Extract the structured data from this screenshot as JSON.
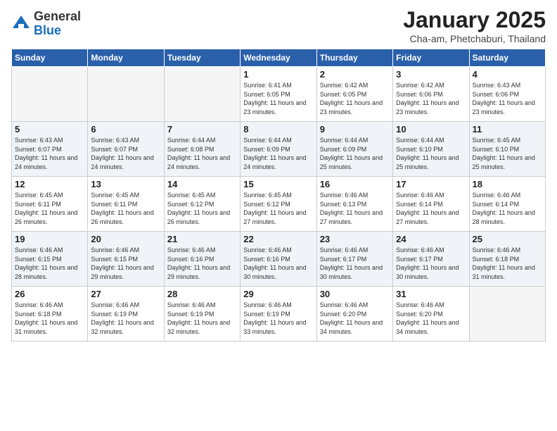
{
  "logo": {
    "general": "General",
    "blue": "Blue"
  },
  "header": {
    "title": "January 2025",
    "subtitle": "Cha-am, Phetchaburi, Thailand"
  },
  "weekdays": [
    "Sunday",
    "Monday",
    "Tuesday",
    "Wednesday",
    "Thursday",
    "Friday",
    "Saturday"
  ],
  "weeks": [
    [
      {
        "day": "",
        "sunrise": "",
        "sunset": "",
        "daylight": "",
        "empty": true
      },
      {
        "day": "",
        "sunrise": "",
        "sunset": "",
        "daylight": "",
        "empty": true
      },
      {
        "day": "",
        "sunrise": "",
        "sunset": "",
        "daylight": "",
        "empty": true
      },
      {
        "day": "1",
        "sunrise": "Sunrise: 6:41 AM",
        "sunset": "Sunset: 6:05 PM",
        "daylight": "Daylight: 11 hours and 23 minutes."
      },
      {
        "day": "2",
        "sunrise": "Sunrise: 6:42 AM",
        "sunset": "Sunset: 6:05 PM",
        "daylight": "Daylight: 11 hours and 23 minutes."
      },
      {
        "day": "3",
        "sunrise": "Sunrise: 6:42 AM",
        "sunset": "Sunset: 6:06 PM",
        "daylight": "Daylight: 11 hours and 23 minutes."
      },
      {
        "day": "4",
        "sunrise": "Sunrise: 6:43 AM",
        "sunset": "Sunset: 6:06 PM",
        "daylight": "Daylight: 11 hours and 23 minutes."
      }
    ],
    [
      {
        "day": "5",
        "sunrise": "Sunrise: 6:43 AM",
        "sunset": "Sunset: 6:07 PM",
        "daylight": "Daylight: 11 hours and 24 minutes."
      },
      {
        "day": "6",
        "sunrise": "Sunrise: 6:43 AM",
        "sunset": "Sunset: 6:07 PM",
        "daylight": "Daylight: 11 hours and 24 minutes."
      },
      {
        "day": "7",
        "sunrise": "Sunrise: 6:44 AM",
        "sunset": "Sunset: 6:08 PM",
        "daylight": "Daylight: 11 hours and 24 minutes."
      },
      {
        "day": "8",
        "sunrise": "Sunrise: 6:44 AM",
        "sunset": "Sunset: 6:09 PM",
        "daylight": "Daylight: 11 hours and 24 minutes."
      },
      {
        "day": "9",
        "sunrise": "Sunrise: 6:44 AM",
        "sunset": "Sunset: 6:09 PM",
        "daylight": "Daylight: 11 hours and 25 minutes."
      },
      {
        "day": "10",
        "sunrise": "Sunrise: 6:44 AM",
        "sunset": "Sunset: 6:10 PM",
        "daylight": "Daylight: 11 hours and 25 minutes."
      },
      {
        "day": "11",
        "sunrise": "Sunrise: 6:45 AM",
        "sunset": "Sunset: 6:10 PM",
        "daylight": "Daylight: 11 hours and 25 minutes."
      }
    ],
    [
      {
        "day": "12",
        "sunrise": "Sunrise: 6:45 AM",
        "sunset": "Sunset: 6:11 PM",
        "daylight": "Daylight: 11 hours and 26 minutes."
      },
      {
        "day": "13",
        "sunrise": "Sunrise: 6:45 AM",
        "sunset": "Sunset: 6:11 PM",
        "daylight": "Daylight: 11 hours and 26 minutes."
      },
      {
        "day": "14",
        "sunrise": "Sunrise: 6:45 AM",
        "sunset": "Sunset: 6:12 PM",
        "daylight": "Daylight: 11 hours and 26 minutes."
      },
      {
        "day": "15",
        "sunrise": "Sunrise: 6:45 AM",
        "sunset": "Sunset: 6:12 PM",
        "daylight": "Daylight: 11 hours and 27 minutes."
      },
      {
        "day": "16",
        "sunrise": "Sunrise: 6:46 AM",
        "sunset": "Sunset: 6:13 PM",
        "daylight": "Daylight: 11 hours and 27 minutes."
      },
      {
        "day": "17",
        "sunrise": "Sunrise: 6:46 AM",
        "sunset": "Sunset: 6:14 PM",
        "daylight": "Daylight: 11 hours and 27 minutes."
      },
      {
        "day": "18",
        "sunrise": "Sunrise: 6:46 AM",
        "sunset": "Sunset: 6:14 PM",
        "daylight": "Daylight: 11 hours and 28 minutes."
      }
    ],
    [
      {
        "day": "19",
        "sunrise": "Sunrise: 6:46 AM",
        "sunset": "Sunset: 6:15 PM",
        "daylight": "Daylight: 11 hours and 28 minutes."
      },
      {
        "day": "20",
        "sunrise": "Sunrise: 6:46 AM",
        "sunset": "Sunset: 6:15 PM",
        "daylight": "Daylight: 11 hours and 29 minutes."
      },
      {
        "day": "21",
        "sunrise": "Sunrise: 6:46 AM",
        "sunset": "Sunset: 6:16 PM",
        "daylight": "Daylight: 11 hours and 29 minutes."
      },
      {
        "day": "22",
        "sunrise": "Sunrise: 6:46 AM",
        "sunset": "Sunset: 6:16 PM",
        "daylight": "Daylight: 11 hours and 30 minutes."
      },
      {
        "day": "23",
        "sunrise": "Sunrise: 6:46 AM",
        "sunset": "Sunset: 6:17 PM",
        "daylight": "Daylight: 11 hours and 30 minutes."
      },
      {
        "day": "24",
        "sunrise": "Sunrise: 6:46 AM",
        "sunset": "Sunset: 6:17 PM",
        "daylight": "Daylight: 11 hours and 30 minutes."
      },
      {
        "day": "25",
        "sunrise": "Sunrise: 6:46 AM",
        "sunset": "Sunset: 6:18 PM",
        "daylight": "Daylight: 11 hours and 31 minutes."
      }
    ],
    [
      {
        "day": "26",
        "sunrise": "Sunrise: 6:46 AM",
        "sunset": "Sunset: 6:18 PM",
        "daylight": "Daylight: 11 hours and 31 minutes."
      },
      {
        "day": "27",
        "sunrise": "Sunrise: 6:46 AM",
        "sunset": "Sunset: 6:19 PM",
        "daylight": "Daylight: 11 hours and 32 minutes."
      },
      {
        "day": "28",
        "sunrise": "Sunrise: 6:46 AM",
        "sunset": "Sunset: 6:19 PM",
        "daylight": "Daylight: 11 hours and 32 minutes."
      },
      {
        "day": "29",
        "sunrise": "Sunrise: 6:46 AM",
        "sunset": "Sunset: 6:19 PM",
        "daylight": "Daylight: 11 hours and 33 minutes."
      },
      {
        "day": "30",
        "sunrise": "Sunrise: 6:46 AM",
        "sunset": "Sunset: 6:20 PM",
        "daylight": "Daylight: 11 hours and 34 minutes."
      },
      {
        "day": "31",
        "sunrise": "Sunrise: 6:46 AM",
        "sunset": "Sunset: 6:20 PM",
        "daylight": "Daylight: 11 hours and 34 minutes."
      },
      {
        "day": "",
        "sunrise": "",
        "sunset": "",
        "daylight": "",
        "empty": true
      }
    ]
  ]
}
